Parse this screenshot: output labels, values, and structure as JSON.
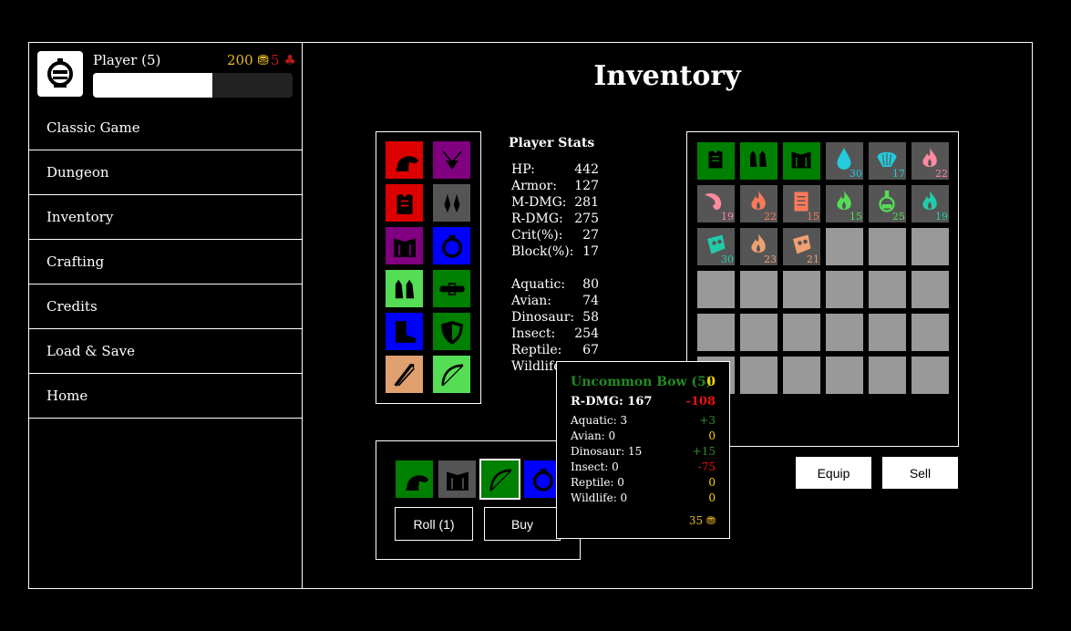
{
  "player": {
    "name": "Player (5)",
    "gold": "200",
    "gems": "5",
    "xp_fraction": 0.6
  },
  "nav": [
    "Classic Game",
    "Dungeon",
    "Inventory",
    "Crafting",
    "Credits",
    "Load & Save",
    "Home"
  ],
  "page_title": "Inventory",
  "stats": {
    "heading": "Player Stats",
    "rows": [
      {
        "label": "HP:",
        "value": "442"
      },
      {
        "label": "Armor:",
        "value": "127"
      },
      {
        "label": "M-DMG:",
        "value": "281"
      },
      {
        "label": "R-DMG:",
        "value": "275"
      },
      {
        "label": "Crit(%):",
        "value": "27"
      },
      {
        "label": "Block(%):",
        "value": "17"
      },
      {
        "label": "Aquatic:",
        "value": "80"
      },
      {
        "label": "Avian:",
        "value": "74"
      },
      {
        "label": "Dinosaur:",
        "value": "58"
      },
      {
        "label": "Insect:",
        "value": "254"
      },
      {
        "label": "Reptile:",
        "value": "67"
      },
      {
        "label": "Wildlife:",
        "value": ""
      }
    ]
  },
  "equipment": [
    {
      "name": "helmet-icon",
      "bg": "#dd0000",
      "fg": "#000000"
    },
    {
      "name": "amulet-icon",
      "bg": "#800080",
      "fg": "#000000"
    },
    {
      "name": "chest-armor-icon",
      "bg": "#dd0000",
      "fg": "#000000"
    },
    {
      "name": "earrings-icon",
      "bg": "#555555",
      "fg": "#000000"
    },
    {
      "name": "shoulder-armor-icon",
      "bg": "#800080",
      "fg": "#000000"
    },
    {
      "name": "ring-icon",
      "bg": "#0000ff",
      "fg": "#000000"
    },
    {
      "name": "gloves-icon",
      "bg": "#55dd55",
      "fg": "#000000"
    },
    {
      "name": "belt-icon",
      "bg": "#008000",
      "fg": "#000000"
    },
    {
      "name": "boots-icon",
      "bg": "#0000ff",
      "fg": "#000000"
    },
    {
      "name": "shield-icon",
      "bg": "#008000",
      "fg": "#000000"
    },
    {
      "name": "quiver-icon",
      "bg": "#e0a070",
      "fg": "#000000"
    },
    {
      "name": "bow-icon",
      "bg": "#55dd55",
      "fg": "#000000"
    }
  ],
  "inventory": [
    {
      "name": "chest-armor-icon",
      "bg": "#008000",
      "fg": "#000000",
      "qty": ""
    },
    {
      "name": "gloves-icon",
      "bg": "#008000",
      "fg": "#000000",
      "qty": ""
    },
    {
      "name": "shoulder-armor-icon",
      "bg": "#008000",
      "fg": "#000000",
      "qty": ""
    },
    {
      "name": "water-drop-icon",
      "bg": "#555555",
      "fg": "#22ccdd",
      "qty": "30"
    },
    {
      "name": "shell-icon",
      "bg": "#555555",
      "fg": "#22ccdd",
      "qty": "17"
    },
    {
      "name": "flame-icon",
      "bg": "#555555",
      "fg": "#ff8aa0",
      "qty": "22"
    },
    {
      "name": "feather-icon",
      "bg": "#555555",
      "fg": "#ff8aa0",
      "qty": "19"
    },
    {
      "name": "flame-icon",
      "bg": "#555555",
      "fg": "#ff7a5a",
      "qty": "22"
    },
    {
      "name": "scroll-icon",
      "bg": "#555555",
      "fg": "#ff7a5a",
      "qty": "15"
    },
    {
      "name": "flame-icon",
      "bg": "#555555",
      "fg": "#55dd55",
      "qty": "15"
    },
    {
      "name": "potion-icon",
      "bg": "#555555",
      "fg": "#55dd55",
      "qty": "25"
    },
    {
      "name": "flame-icon",
      "bg": "#555555",
      "fg": "#22ccaa",
      "qty": "19"
    },
    {
      "name": "mask-icon",
      "bg": "#555555",
      "fg": "#22ccaa",
      "qty": "30"
    },
    {
      "name": "flame-icon",
      "bg": "#555555",
      "fg": "#f0a070",
      "qty": "23"
    },
    {
      "name": "mask-icon",
      "bg": "#555555",
      "fg": "#f0a070",
      "qty": "21"
    }
  ],
  "inventory_slots": 36,
  "buttons": {
    "equip": "Equip",
    "sell": "Sell",
    "roll": "Roll (1)",
    "buy": "Buy"
  },
  "shop": [
    {
      "name": "helmet-icon",
      "bg": "#008000",
      "fg": "#000000"
    },
    {
      "name": "shoulder-armor-icon",
      "bg": "#555555",
      "fg": "#000000"
    },
    {
      "name": "bow-icon",
      "bg": "#008000",
      "fg": "#000000",
      "selected": true
    },
    {
      "name": "ring-icon",
      "bg": "#0000ff",
      "fg": "#000000"
    }
  ],
  "tooltip": {
    "title": "Uncommon Bow (5)",
    "title_delta": "0",
    "main_stat": "R-DMG: 167",
    "main_delta": "-108",
    "rows": [
      {
        "label": "Aquatic: 3",
        "delta": "+3",
        "color": "#2e8b2e"
      },
      {
        "label": "Avian: 0",
        "delta": "0",
        "color": "#ffd700"
      },
      {
        "label": "Dinosaur: 15",
        "delta": "+15",
        "color": "#2e8b2e"
      },
      {
        "label": "Insect: 0",
        "delta": "-75",
        "color": "#ee1111"
      },
      {
        "label": "Reptile: 0",
        "delta": "0",
        "color": "#ffd700"
      },
      {
        "label": "Wildlife: 0",
        "delta": "0",
        "color": "#ffd700"
      }
    ],
    "price": "35"
  }
}
